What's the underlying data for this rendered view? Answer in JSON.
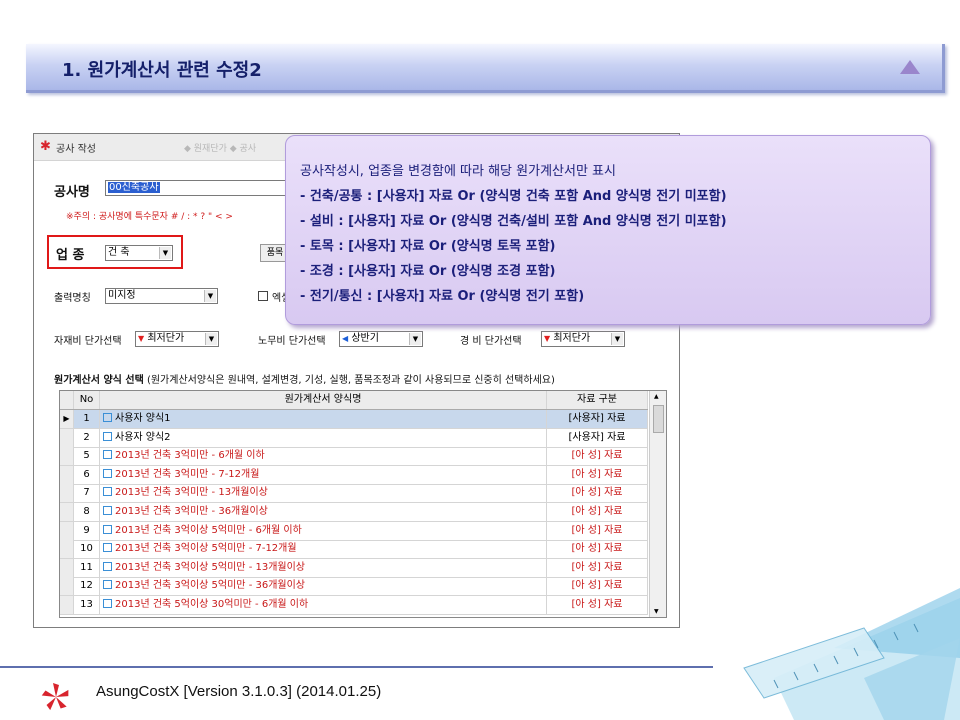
{
  "header": {
    "title": "1. 원가계산서 관련 수정2"
  },
  "window": {
    "title": "공사 작성",
    "faded_tabs": "◆ 원재단가 ◆ 공사"
  },
  "form": {
    "project_name_label": "공사명",
    "project_name_value": "00신축공사",
    "warning": "※주의 : 공사명에 특수문자 # / : * ? \" < >",
    "industry_label": "업  종",
    "industry_value": "건 축",
    "item_button": "품목",
    "print_label": "출력명칭",
    "print_value": "미지정",
    "excel_label": "엑셀",
    "material_label": "자재비 단가선택",
    "material_value": "최저단가",
    "labor_label": "노무비 단가선택",
    "labor_value": "상반기",
    "expense_label": "경  비 단가선택",
    "expense_value": "최저단가"
  },
  "grid": {
    "title_bold": "원가계산서 양식 선택",
    "title_note": "(원가계산서양식은 원내역, 설계변경, 기성, 실행, 품목조정과 같이 사용되므로 신중히 선택하세요)",
    "columns": [
      "No",
      "원가계산서 양식명",
      "자료 구분"
    ],
    "rows": [
      {
        "no": "1",
        "name": "사용자 양식1",
        "type": "[사용자] 자료",
        "red": false,
        "selected": true
      },
      {
        "no": "2",
        "name": "사용자 양식2",
        "type": "[사용자] 자료",
        "red": false,
        "selected": false
      },
      {
        "no": "5",
        "name": "2013년 건축 3억미만 - 6개월 이하",
        "type": "[아  성] 자료",
        "red": true,
        "selected": false
      },
      {
        "no": "6",
        "name": "2013년 건축 3억미만 - 7-12개월",
        "type": "[아  성] 자료",
        "red": true,
        "selected": false
      },
      {
        "no": "7",
        "name": "2013년 건축 3억미만 - 13개월이상",
        "type": "[아  성] 자료",
        "red": true,
        "selected": false
      },
      {
        "no": "8",
        "name": "2013년 건축 3억미만  - 36개월이상",
        "type": "[아  성] 자료",
        "red": true,
        "selected": false
      },
      {
        "no": "9",
        "name": "2013년 건축 3억이상 5억미만 - 6개월 이하",
        "type": "[아  성] 자료",
        "red": true,
        "selected": false
      },
      {
        "no": "10",
        "name": "2013년 건축 3억이상 5억미만 - 7-12개월",
        "type": "[아  성] 자료",
        "red": true,
        "selected": false
      },
      {
        "no": "11",
        "name": "2013년 건축 3억이상 5억미만 - 13개월이상",
        "type": "[아  성] 자료",
        "red": true,
        "selected": false
      },
      {
        "no": "12",
        "name": "2013년 건축 3억이상 5억미만 - 36개월이상",
        "type": "[아  성] 자료",
        "red": true,
        "selected": false
      },
      {
        "no": "13",
        "name": "2013년 건축 5억이상 30억미만 - 6개월 이하",
        "type": "[아  성] 자료",
        "red": true,
        "selected": false
      }
    ]
  },
  "callout": {
    "lines": [
      "공사작성시, 업종을 변경함에 따라 해당 원가계산서만 표시",
      " - 건축/공통 : [사용자] 자료 Or (양식명 건축 포함 And 양식명 전기 미포함)",
      " - 설비        : [사용자] 자료 Or (양식명 건축/설비 포함 And 양식명 전기 미포함)",
      " - 토목        : [사용자] 자료 Or (양식명 토목 포함)",
      " - 조경        : [사용자] 자료 Or (양식명 조경 포함)",
      " - 전기/통신 : [사용자] 자료 Or (양식명 전기 포함)"
    ]
  },
  "footer": {
    "text": "AsungCostX   [Version 3.1.0.3]    (2014.01.25)"
  },
  "colors": {
    "header_text": "#15206a",
    "callout_bg": "#d8c9f1",
    "warning": "#d01d1d",
    "highlight": "#e01818"
  }
}
